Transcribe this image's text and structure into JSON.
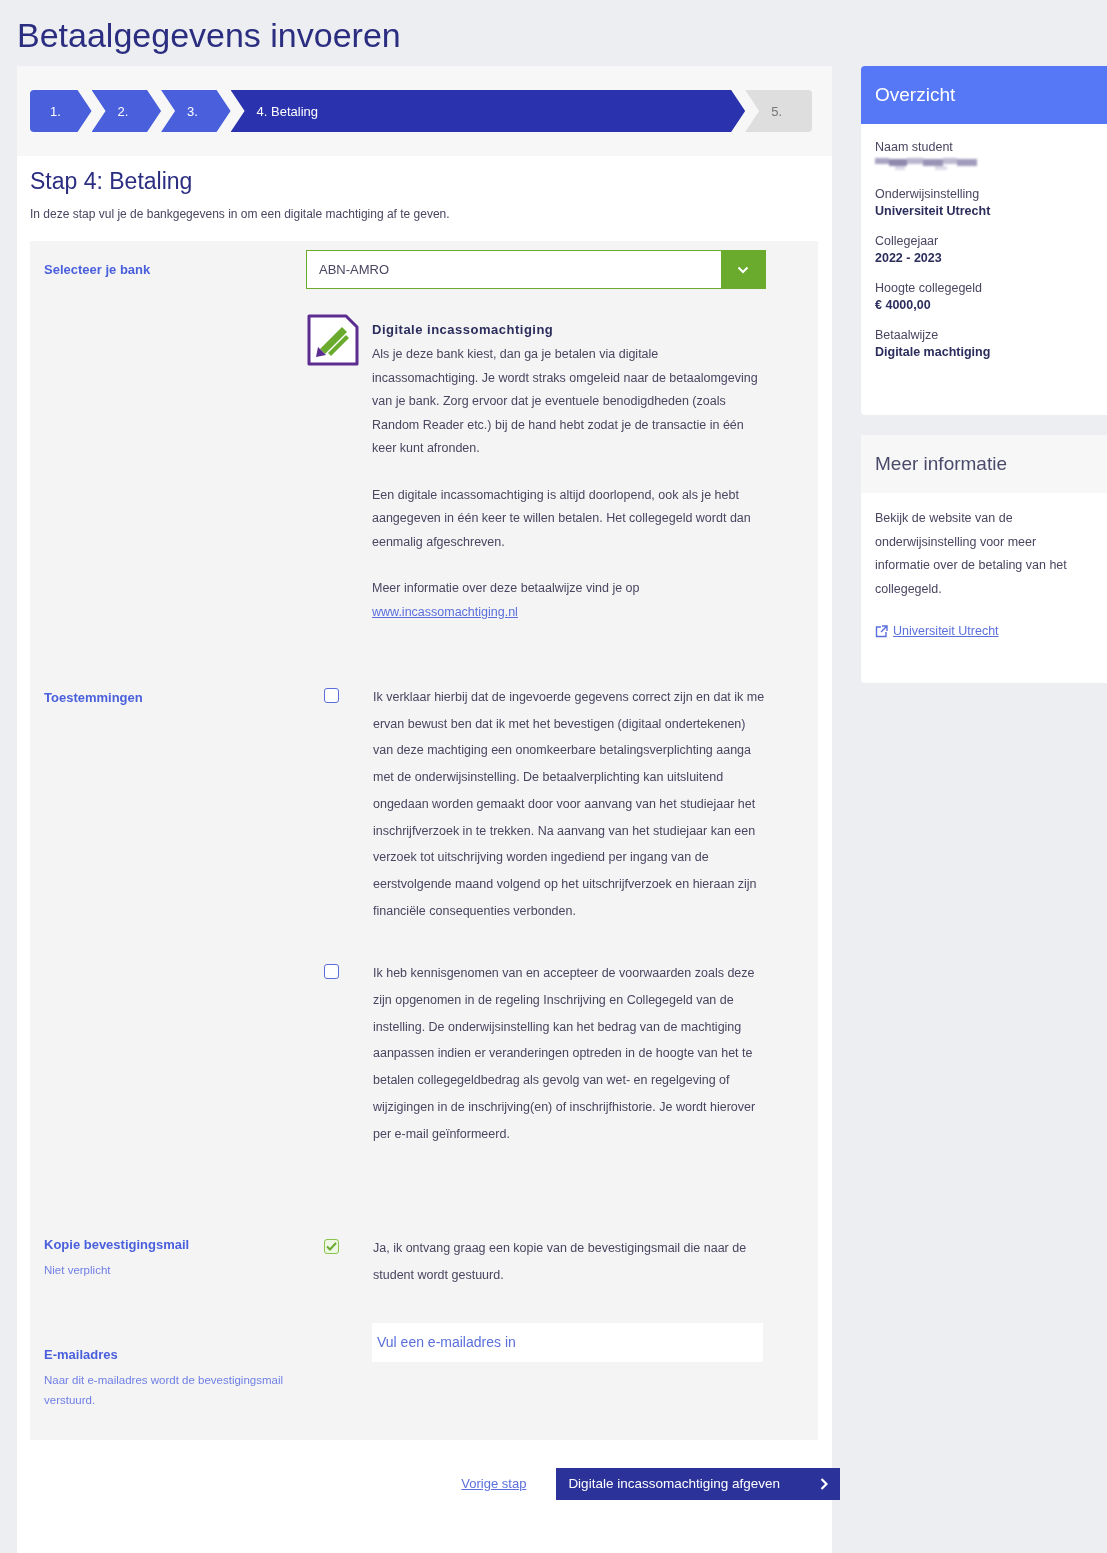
{
  "page_title": "Betaalgegevens invoeren",
  "steps": [
    {
      "label": "1.",
      "completed": true,
      "selected": false
    },
    {
      "label": "2.",
      "completed": true,
      "selected": false
    },
    {
      "label": "3.",
      "completed": true,
      "selected": false
    },
    {
      "label": "4. Betaling",
      "completed": false,
      "selected": true
    },
    {
      "label": "5.",
      "completed": false,
      "selected": false
    }
  ],
  "step_heading": "Stap 4: Betaling",
  "step_intro": "In deze stap vul je de bankgegevens in om een digitale machtiging af te geven.",
  "bank": {
    "label": "Selecteer je bank",
    "value": "ABN-AMRO"
  },
  "method": {
    "title": "Digitale incassomachtiging",
    "paragraphs": [
      "Als je deze bank kiest, dan ga je betalen via digitale incassomachtiging. Je wordt straks omgeleid naar de betaalomgeving van je bank. Zorg ervoor dat je eventuele benodigdheden (zoals Random Reader etc.) bij de hand hebt zodat je de transactie in één keer kunt afronden.",
      "Een digitale incassomachtiging is altijd doorlopend, ook als je hebt aangegeven in één keer te willen betalen. Het collegegeld wordt dan eenmalig afgeschreven."
    ],
    "more_text": "Meer informatie over deze betaalwijze vind je op",
    "link": "www.incassomachtiging.nl"
  },
  "consents": {
    "label": "Toestemmingen",
    "items": [
      {
        "text": "Ik verklaar hierbij dat de ingevoerde gegevens correct zijn en dat ik me ervan bewust ben dat ik met het bevestigen (digitaal ondertekenen) van deze machtiging een onomkeerbare betalingsverplichting aanga met de onderwijsinstelling. De betaalverplichting kan uitsluitend ongedaan worden gemaakt door voor aanvang van het studiejaar het inschrijfverzoek in te trekken. Na aanvang van het studiejaar kan een verzoek tot uitschrijving worden ingediend per ingang van de eerstvolgende maand volgend op het uitschrijfverzoek en hieraan zijn financiële consequenties verbonden.",
        "checked": false
      },
      {
        "text": "Ik heb kennisgenomen van en accepteer de voorwaarden zoals deze zijn opgenomen in de regeling Inschrijving en Collegegeld van de instelling. De onderwijsinstelling kan het bedrag van de machtiging aanpassen indien er veranderingen optreden in de hoogte van het te betalen collegegeldbedrag als gevolg van wet- en regelgeving of wijzigingen in de inschrijving(en) of inschrijfhistorie. Je wordt hierover per e-mail geïnformeerd.",
        "checked": false
      }
    ]
  },
  "copy_mail": {
    "label": "Kopie bevestigingsmail",
    "hint": "Niet verplicht",
    "text": "Ja, ik ontvang graag een kopie van de bevestigingsmail die naar de student wordt gestuurd.",
    "checked": true
  },
  "email": {
    "label": "E-mailadres",
    "hint": "Naar dit e-mailadres wordt de bevestigingsmail verstuurd.",
    "placeholder": "Vul een e-mailadres in"
  },
  "actions": {
    "back": "Vorige stap",
    "submit": "Digitale incassomachtiging afgeven"
  },
  "overview": {
    "title": "Overzicht",
    "items": [
      {
        "label": "Naam student",
        "kind": "redacted"
      },
      {
        "label": "Onderwijsinstelling",
        "kind": "text",
        "value": "Universiteit Utrecht"
      },
      {
        "label": "Collegejaar",
        "kind": "text",
        "value": "2022 - 2023"
      },
      {
        "label": "Hoogte collegegeld",
        "kind": "text",
        "value": "€ 4000,00"
      },
      {
        "label": "Betaalwijze",
        "kind": "text",
        "value": "Digitale machtiging"
      }
    ]
  },
  "more_info": {
    "title": "Meer informatie",
    "text": "Bekijk de website van de onderwijsinstelling voor meer informatie over de betaling van het collegegeld.",
    "link": "Universiteit Utrecht"
  }
}
